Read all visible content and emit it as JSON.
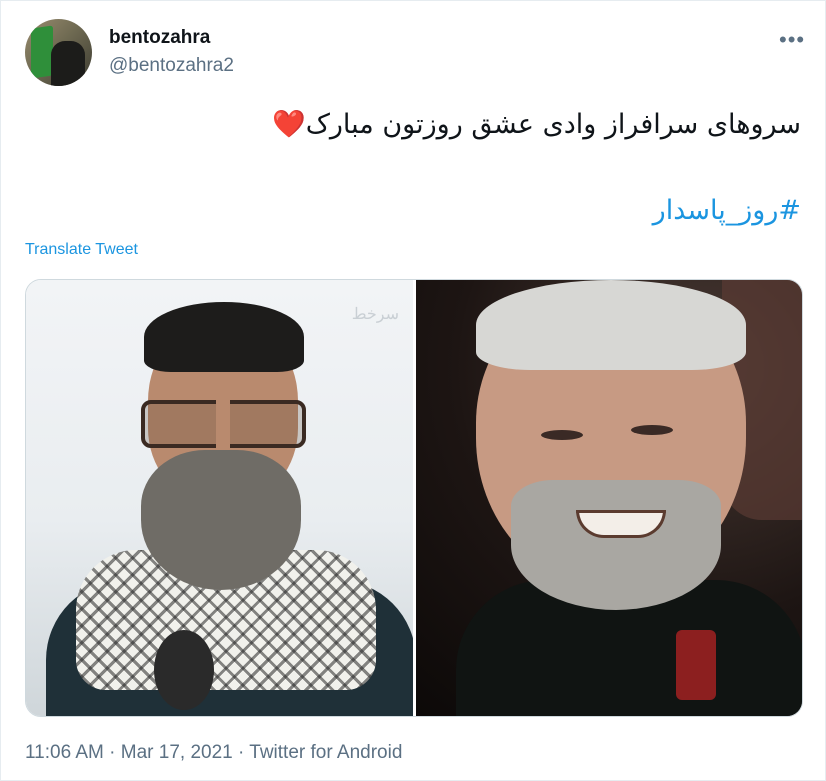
{
  "user": {
    "display_name": "bentozahra",
    "handle": "@bentozahra2"
  },
  "header": {
    "more_icon": "more-horizontal-icon",
    "more_label": "•••"
  },
  "tweet": {
    "text": "سروهای سرافراز وادی عشق روزتون مبارک",
    "emoji": "❤️",
    "hashtag": "#روز_پاسدار",
    "translate_label": "Translate Tweet"
  },
  "media": {
    "left_watermark": "سرخط"
  },
  "meta": {
    "time": "11:06 AM",
    "separator": " · ",
    "date": "Mar 17, 2021",
    "source": "Twitter for Android"
  },
  "colors": {
    "link": "#1b95e0",
    "secondary_text": "#5b7083",
    "heart": "#e0245e"
  }
}
